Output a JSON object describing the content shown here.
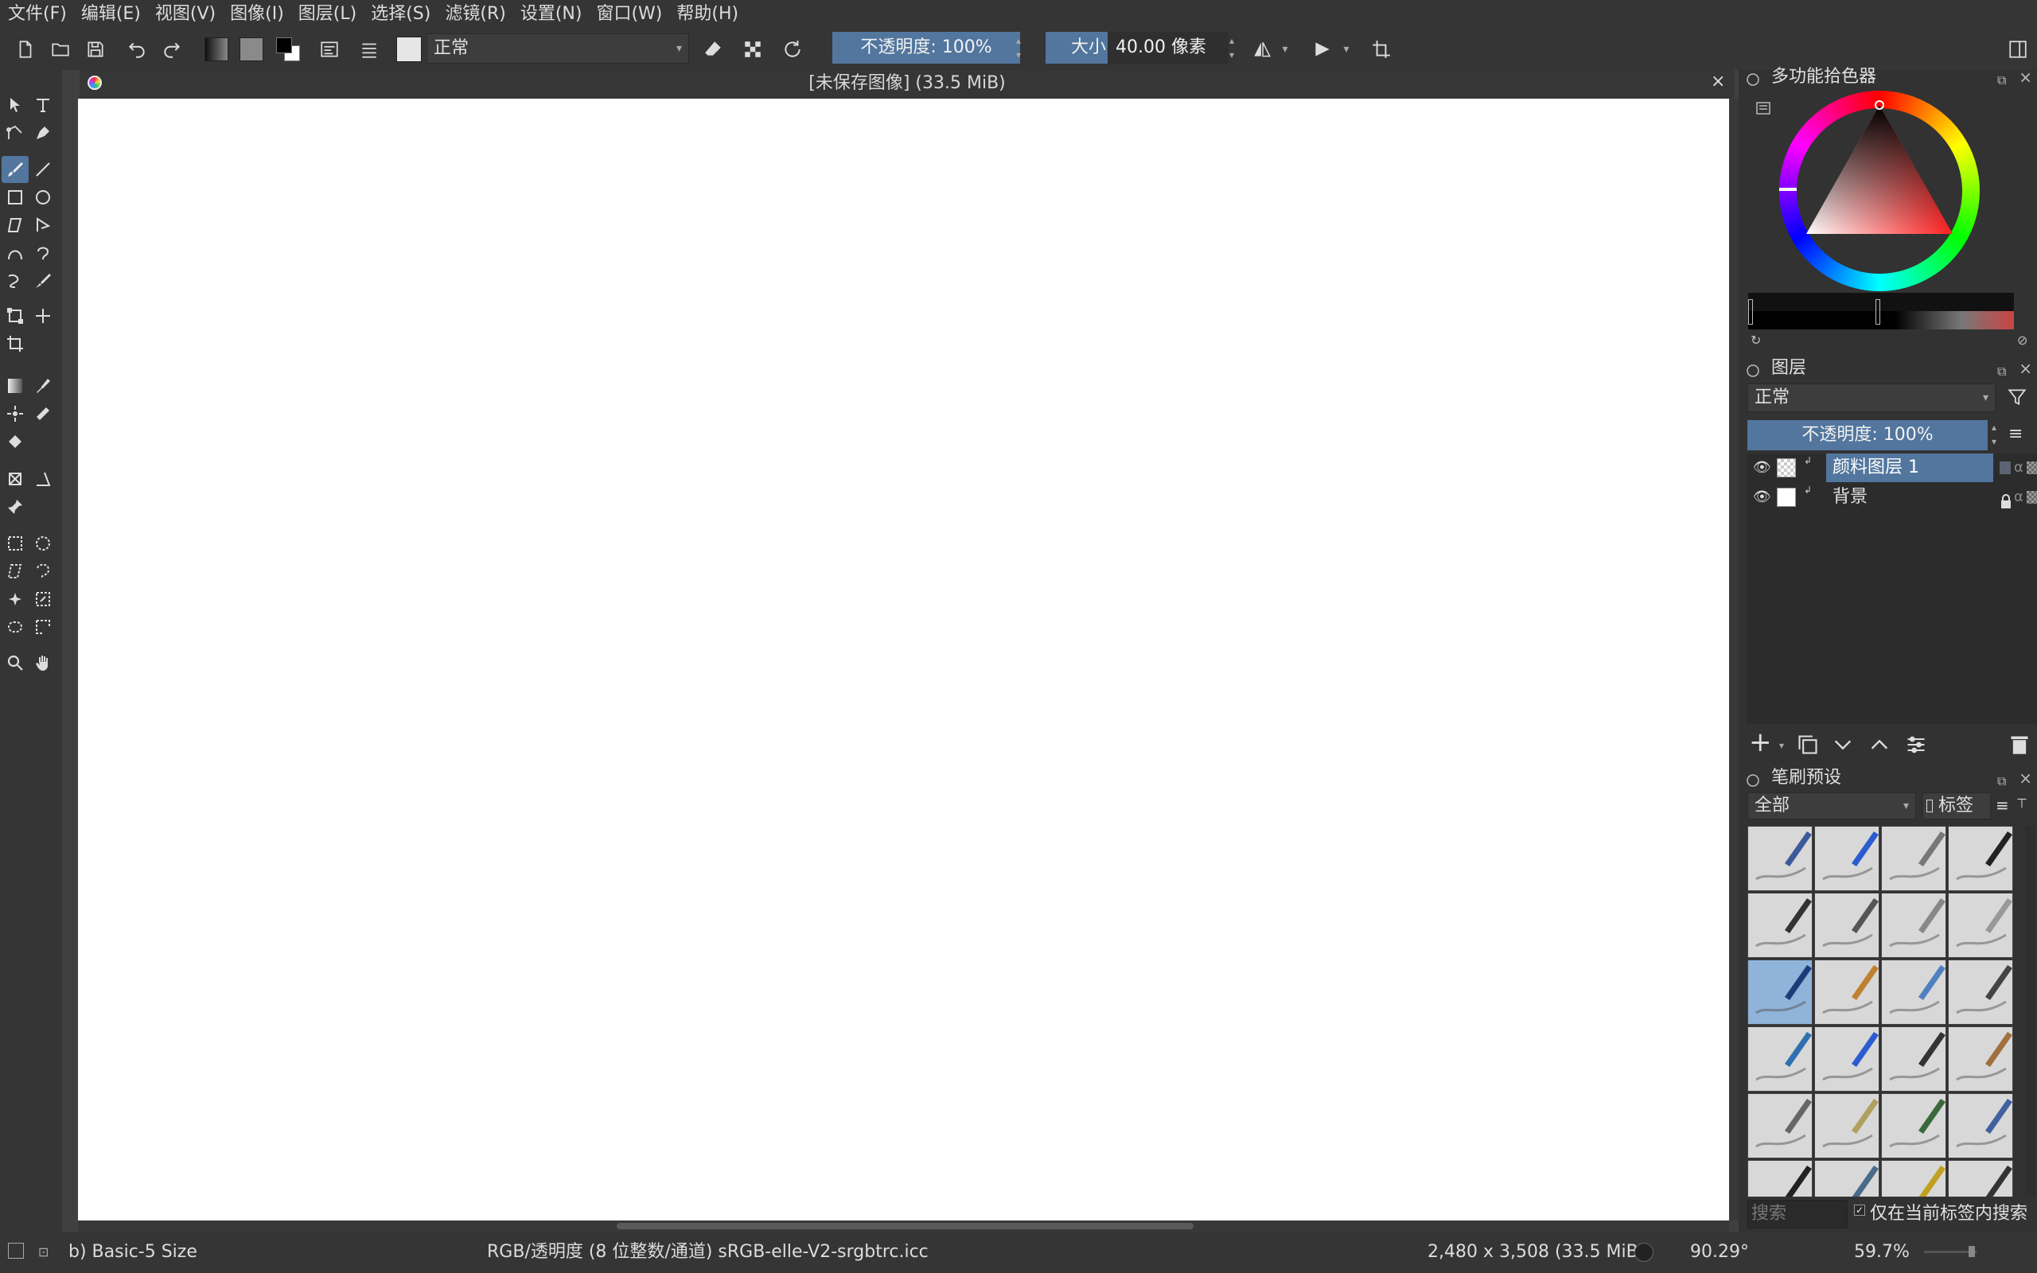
{
  "menu": [
    "文件(F)",
    "编辑(E)",
    "视图(V)",
    "图像(I)",
    "图层(L)",
    "选择(S)",
    "滤镜(R)",
    "设置(N)",
    "窗口(W)",
    "帮助(H)"
  ],
  "toolbar": {
    "blend_mode": "正常",
    "opacity_label": "不透明度: 100%",
    "opacity_value": 1.0,
    "size_label": "大小",
    "size_value": "40.00 像素"
  },
  "document": {
    "title": "[未保存图像]  (33.5 MiB)"
  },
  "color_selector": {
    "title": "多功能拾色器"
  },
  "layers": {
    "title": "图层",
    "blend_mode": "正常",
    "opacity_label": "不透明度:  100%",
    "items": [
      {
        "name": "颜料图层 1",
        "selected": true
      },
      {
        "name": "背景",
        "selected": false
      }
    ]
  },
  "brush_presets": {
    "title": "笔刷预设",
    "filter": "全部",
    "tag_label": "标签",
    "search_placeholder": "搜索",
    "search_in_tag_label": "仅在当前标签内搜索"
  },
  "status": {
    "brush": "b) Basic-5 Size",
    "colorspace": "RGB/透明度 (8 位整数/通道)  sRGB-elle-V2-srgbtrc.icc",
    "dimensions": "2,480 x 3,508 (33.5 MiB)",
    "rotation": "90.29°",
    "zoom": "59.7%"
  },
  "colors": {
    "accent": "#52769e",
    "panel_bg": "#323232",
    "canvas_bg": "#ffffff"
  }
}
